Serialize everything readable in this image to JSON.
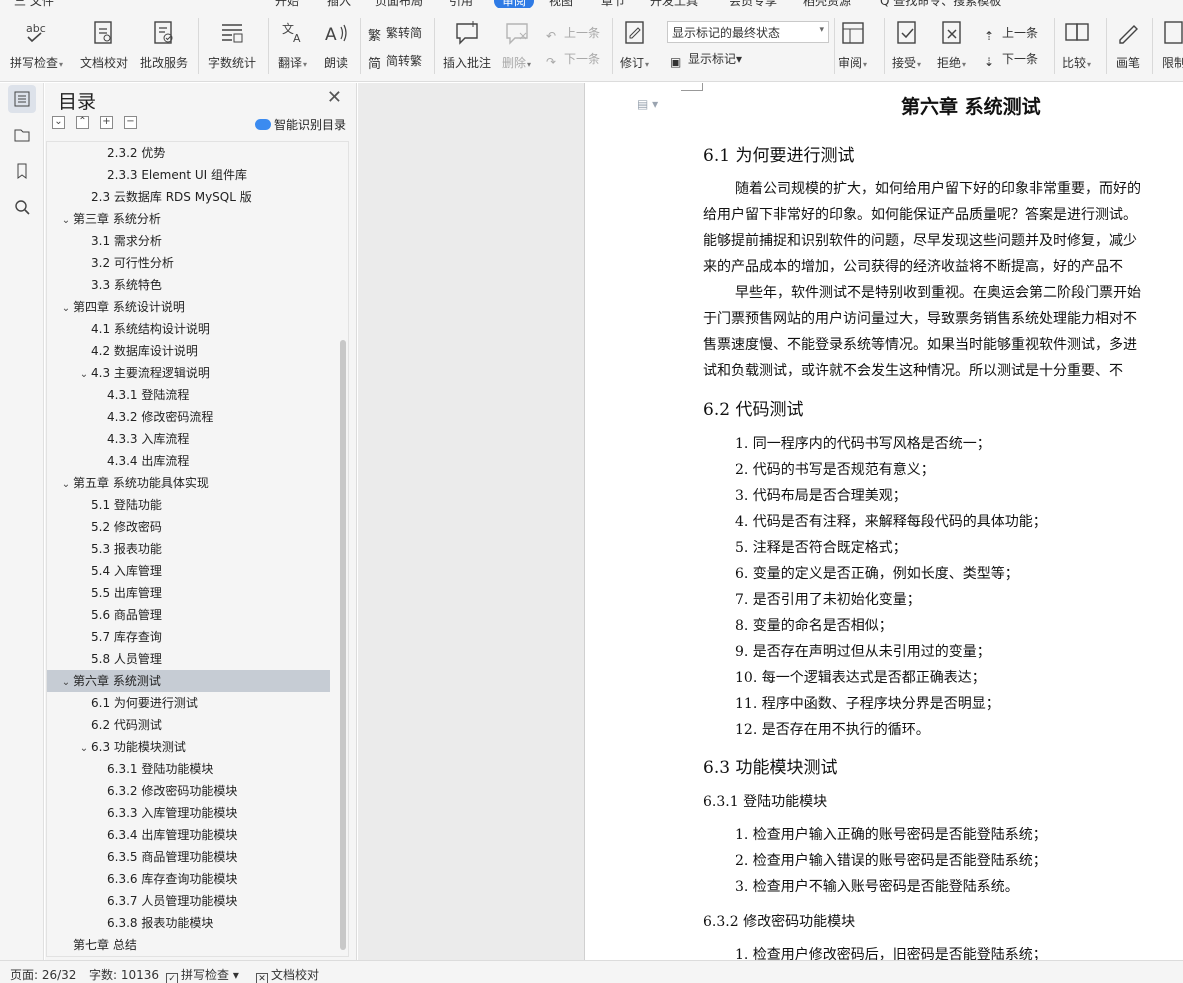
{
  "menu": {
    "items": [
      {
        "label": "三 文件"
      },
      {
        "label": "开始"
      },
      {
        "label": "插入"
      },
      {
        "label": "页面布局"
      },
      {
        "label": "引用"
      },
      {
        "label": "审阅"
      },
      {
        "label": "视图"
      },
      {
        "label": "章节"
      },
      {
        "label": "开发工具"
      },
      {
        "label": "会员专享"
      },
      {
        "label": "稻壳资源"
      },
      {
        "label": "Q 查找命令、搜索模板"
      }
    ],
    "active": "审阅"
  },
  "ribbon": {
    "spell_check": "拼写检查",
    "doc_proof": "文档校对",
    "batch_service": "批改服务",
    "word_count": "字数统计",
    "translate": "翻译",
    "read_aloud": "朗读",
    "trad_to_simp": "繁转简",
    "simp_to_trad": "简转繁",
    "insert_comment": "插入批注",
    "delete": "删除",
    "prev_comment": "上一条",
    "next_comment": "下一条",
    "revise": "修订",
    "markup_state": "显示标记的最终状态",
    "show_markup": "显示标记",
    "review": "审阅",
    "accept": "接受",
    "reject": "拒绝",
    "prev_change": "上一条",
    "next_change": "下一条",
    "compare": "比较",
    "ink": "画笔",
    "restrict": "限制"
  },
  "toc": {
    "title": "目录",
    "smart_label": "智能识别目录",
    "items": [
      {
        "label": "2.3.2  优势",
        "level": 3,
        "caret": ""
      },
      {
        "label": "2.3.3 Element UI 组件库",
        "level": 3,
        "caret": ""
      },
      {
        "label": "2.3  云数据库 RDS MySQL 版",
        "level": 2,
        "caret": ""
      },
      {
        "label": "第三章  系统分析",
        "level": 1,
        "caret": "⌄"
      },
      {
        "label": "3.1  需求分析",
        "level": 2,
        "caret": ""
      },
      {
        "label": "3.2  可行性分析",
        "level": 2,
        "caret": ""
      },
      {
        "label": "3.3  系统特色",
        "level": 2,
        "caret": ""
      },
      {
        "label": "第四章  系统设计说明",
        "level": 1,
        "caret": "⌄"
      },
      {
        "label": "4.1  系统结构设计说明",
        "level": 2,
        "caret": ""
      },
      {
        "label": "4.2  数据库设计说明",
        "level": 2,
        "caret": ""
      },
      {
        "label": "4.3  主要流程逻辑说明",
        "level": 2,
        "caret": "⌄"
      },
      {
        "label": "4.3.1  登陆流程",
        "level": 3,
        "caret": ""
      },
      {
        "label": "4.3.2  修改密码流程",
        "level": 3,
        "caret": ""
      },
      {
        "label": "4.3.3  入库流程",
        "level": 3,
        "caret": ""
      },
      {
        "label": "4.3.4  出库流程",
        "level": 3,
        "caret": ""
      },
      {
        "label": "第五章  系统功能具体实现",
        "level": 1,
        "caret": "⌄"
      },
      {
        "label": "5.1  登陆功能",
        "level": 2,
        "caret": ""
      },
      {
        "label": "5.2  修改密码",
        "level": 2,
        "caret": ""
      },
      {
        "label": "5.3  报表功能",
        "level": 2,
        "caret": ""
      },
      {
        "label": "5.4  入库管理",
        "level": 2,
        "caret": ""
      },
      {
        "label": "5.5  出库管理",
        "level": 2,
        "caret": ""
      },
      {
        "label": "5.6  商品管理",
        "level": 2,
        "caret": ""
      },
      {
        "label": "5.7  库存查询",
        "level": 2,
        "caret": ""
      },
      {
        "label": "5.8  人员管理",
        "level": 2,
        "caret": ""
      },
      {
        "label": "第六章  系统测试",
        "level": 1,
        "caret": "⌄",
        "selected": true
      },
      {
        "label": "6.1  为何要进行测试",
        "level": 2,
        "caret": ""
      },
      {
        "label": "6.2  代码测试",
        "level": 2,
        "caret": ""
      },
      {
        "label": "6.3  功能模块测试",
        "level": 2,
        "caret": "⌄"
      },
      {
        "label": "6.3.1  登陆功能模块",
        "level": 3,
        "caret": ""
      },
      {
        "label": "6.3.2  修改密码功能模块",
        "level": 3,
        "caret": ""
      },
      {
        "label": "6.3.3  入库管理功能模块",
        "level": 3,
        "caret": ""
      },
      {
        "label": "6.3.4  出库管理功能模块",
        "level": 3,
        "caret": ""
      },
      {
        "label": "6.3.5  商品管理功能模块",
        "level": 3,
        "caret": ""
      },
      {
        "label": "6.3.6  库存查询功能模块",
        "level": 3,
        "caret": ""
      },
      {
        "label": "6.3.7  人员管理功能模块",
        "level": 3,
        "caret": ""
      },
      {
        "label": "6.3.8  报表功能模块",
        "level": 3,
        "caret": ""
      },
      {
        "label": "第七章  总结",
        "level": 1,
        "caret": ""
      }
    ]
  },
  "document": {
    "chapter_title": "第六章  系统测试",
    "s61": "6.1  为何要进行测试",
    "p1": [
      "随着公司规模的扩大，如何给用户留下好的印象非常重要，而好的",
      "给用户留下非常好的印象。如何能保证产品质量呢？答案是进行测试。",
      "能够提前捕捉和识别软件的问题，尽早发现这些问题并及时修复，减少",
      "来的产品成本的增加，公司获得的经济收益将不断提高，好的产品不"
    ],
    "p2": [
      "早些年，软件测试不是特别收到重视。在奥运会第二阶段门票开始",
      "于门票预售网站的用户访问量过大，导致票务销售系统处理能力相对不",
      "售票速度慢、不能登录系统等情况。如果当时能够重视软件测试，多进",
      "试和负载测试，或许就不会发生这种情况。所以测试是十分重要、不"
    ],
    "s62": "6.2  代码测试",
    "list62": [
      "1.  同一程序内的代码书写风格是否统一；",
      "2.  代码的书写是否规范有意义；",
      "3.  代码布局是否合理美观；",
      "4.  代码是否有注释，来解释每段代码的具体功能；",
      "5.  注释是否符合既定格式；",
      "6.  变量的定义是否正确，例如长度、类型等；",
      "7.  是否引用了未初始化变量；",
      "8.  变量的命名是否相似；",
      "9.  是否存在声明过但从未引用过的变量；",
      "10.  每一个逻辑表达式是否都正确表达；",
      "11.  程序中函数、子程序块分界是否明显；",
      "12.  是否存在用不执行的循环。"
    ],
    "s63": "6.3  功能模块测试",
    "s631": "6.3.1  登陆功能模块",
    "list631": [
      "1.  检查用户输入正确的账号密码是否能登陆系统；",
      "2.  检查用户输入错误的账号密码是否能登陆系统；",
      "3.  检查用户不输入账号密码是否能登陆系统。"
    ],
    "s632": "6.3.2  修改密码功能模块",
    "list632": [
      "1.  检查用户修改密码后，旧密码是否能登陆系统；"
    ]
  },
  "status": {
    "page": "页面: 26/32",
    "words": "字数: 10136",
    "spell": "拼写检查",
    "proof": "文档校对"
  }
}
